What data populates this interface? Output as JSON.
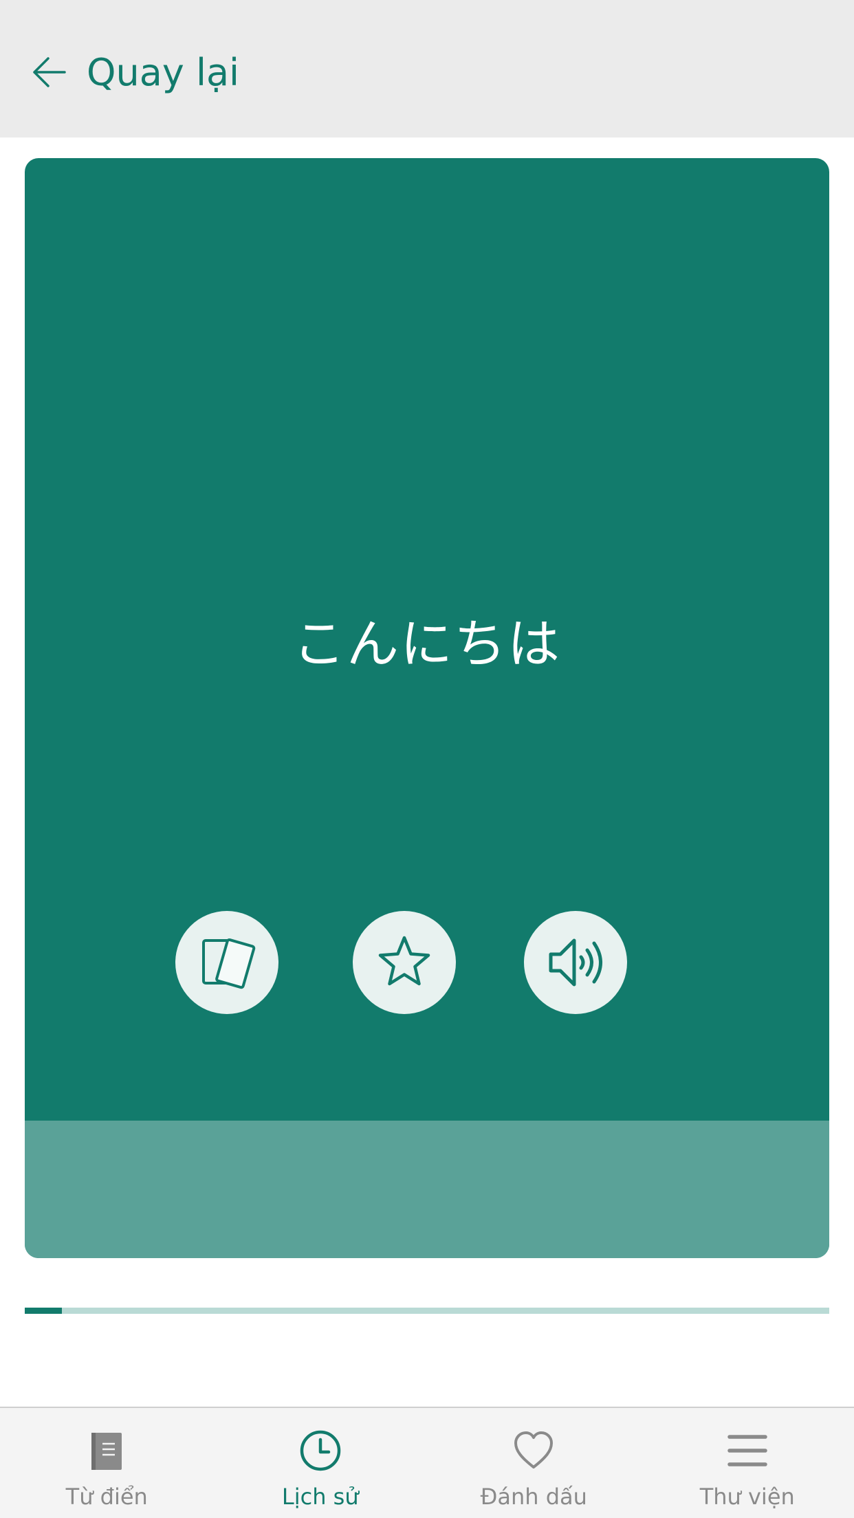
{
  "header": {
    "back_label": "Quay lại"
  },
  "card": {
    "word": "こんにちは",
    "actions": [
      {
        "icon": "flip-cards-icon"
      },
      {
        "icon": "star-icon"
      },
      {
        "icon": "speaker-icon"
      }
    ]
  },
  "progress": {
    "fraction": 0.046
  },
  "tabbar": {
    "active": "history",
    "tabs": [
      {
        "id": "dictionary",
        "label": "Từ điển",
        "icon": "book-icon"
      },
      {
        "id": "history",
        "label": "Lịch sử",
        "icon": "clock-icon"
      },
      {
        "id": "bookmarks",
        "label": "Đánh dấu",
        "icon": "heart-icon"
      },
      {
        "id": "library",
        "label": "Thư viện",
        "icon": "menu-icon"
      }
    ]
  },
  "colors": {
    "accent": "#127b6c",
    "card_bottom": "#5aa298",
    "progress_track": "#b9dad5",
    "inactive": "#8a8a8a"
  }
}
